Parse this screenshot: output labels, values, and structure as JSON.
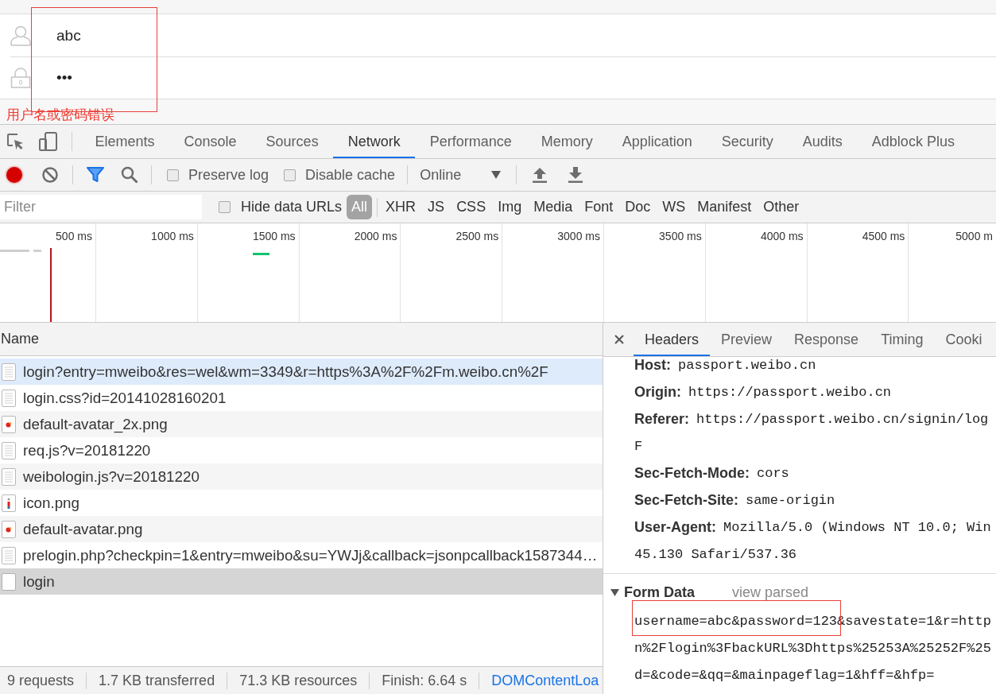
{
  "login_form": {
    "username": "abc",
    "password": "•••",
    "error": "用户名或密码错误"
  },
  "devtools": {
    "tabs": [
      {
        "label": "Elements",
        "selected": false
      },
      {
        "label": "Console",
        "selected": false
      },
      {
        "label": "Sources",
        "selected": false
      },
      {
        "label": "Network",
        "selected": true
      },
      {
        "label": "Performance",
        "selected": false
      },
      {
        "label": "Memory",
        "selected": false
      },
      {
        "label": "Application",
        "selected": false
      },
      {
        "label": "Security",
        "selected": false
      },
      {
        "label": "Audits",
        "selected": false
      },
      {
        "label": "Adblock Plus",
        "selected": false
      }
    ],
    "toolbar": {
      "recording": true,
      "filter_active": true,
      "options": [
        {
          "label": "Preserve log",
          "checked": false
        },
        {
          "label": "Disable cache",
          "checked": false
        }
      ],
      "throttling": "Online"
    },
    "filter_bar": {
      "placeholder": "Filter",
      "hide_data_urls": {
        "label": "Hide data URLs",
        "checked": false
      },
      "types": [
        {
          "label": "All",
          "selected": true
        },
        {
          "label": "XHR",
          "selected": false
        },
        {
          "label": "JS",
          "selected": false
        },
        {
          "label": "CSS",
          "selected": false
        },
        {
          "label": "Img",
          "selected": false
        },
        {
          "label": "Media",
          "selected": false
        },
        {
          "label": "Font",
          "selected": false
        },
        {
          "label": "Doc",
          "selected": false
        },
        {
          "label": "WS",
          "selected": false
        },
        {
          "label": "Manifest",
          "selected": false
        },
        {
          "label": "Other",
          "selected": false
        }
      ]
    },
    "timeline": {
      "ticks": [
        "500 ms",
        "1000 ms",
        "1500 ms",
        "2000 ms",
        "2500 ms",
        "3000 ms",
        "3500 ms",
        "4000 ms",
        "4500 ms",
        "5000 m"
      ]
    },
    "requests": {
      "column": "Name",
      "rows": [
        {
          "name": "login?entry=mweibo&res=wel&wm=3349&r=https%3A%2F%2Fm.weibo.cn%2F",
          "kind": "document",
          "selected": false,
          "highlighted": true
        },
        {
          "name": "login.css?id=20141028160201",
          "kind": "document",
          "selected": false,
          "highlighted": false
        },
        {
          "name": "default-avatar_2x.png",
          "kind": "image",
          "selected": false,
          "highlighted": false
        },
        {
          "name": "req.js?v=20181220",
          "kind": "document",
          "selected": false,
          "highlighted": false
        },
        {
          "name": "weibologin.js?v=20181220",
          "kind": "document",
          "selected": false,
          "highlighted": false
        },
        {
          "name": "icon.png",
          "kind": "image-tall",
          "selected": false,
          "highlighted": false
        },
        {
          "name": "default-avatar.png",
          "kind": "image",
          "selected": false,
          "highlighted": false
        },
        {
          "name": "prelogin.php?checkpin=1&entry=mweibo&su=YWJj&callback=jsonpcallback1587344…",
          "kind": "document",
          "selected": false,
          "highlighted": false
        },
        {
          "name": "login",
          "kind": "blank",
          "selected": true,
          "highlighted": false
        }
      ]
    },
    "status_bar": [
      {
        "text": "9 requests",
        "kind": "stat"
      },
      {
        "text": "1.7 KB transferred",
        "kind": "stat"
      },
      {
        "text": "71.3 KB resources",
        "kind": "stat"
      },
      {
        "text": "Finish: 6.64 s",
        "kind": "stat"
      },
      {
        "text": "DOMContentLoa",
        "kind": "event"
      }
    ],
    "details": {
      "tabs": [
        {
          "label": "Headers",
          "selected": true
        },
        {
          "label": "Preview",
          "selected": false
        },
        {
          "label": "Response",
          "selected": false
        },
        {
          "label": "Timing",
          "selected": false
        },
        {
          "label": "Cooki",
          "selected": false
        }
      ],
      "headers": [
        {
          "name": "Host:",
          "value": "passport.weibo.cn"
        },
        {
          "name": "Origin:",
          "value": "https://passport.weibo.cn"
        },
        {
          "name": "Referer:",
          "value": "https://passport.weibo.cn/signin/log"
        },
        {
          "value": "F"
        },
        {
          "name": "Sec-Fetch-Mode:",
          "value": "cors"
        },
        {
          "name": "Sec-Fetch-Site:",
          "value": "same-origin"
        },
        {
          "name": "User-Agent:",
          "value": "Mozilla/5.0 (Windows NT 10.0; Win"
        },
        {
          "value": "45.130 Safari/537.36"
        }
      ],
      "form_data": {
        "title": "Form Data",
        "expanded": true,
        "toggle": "view parsed",
        "lines": [
          "username=abc&password=123&savestate=1&r=http",
          "n%2Flogin%3FbackURL%3Dhttps%25253A%25252F%25",
          "d=&code=&qq=&mainpageflag=1&hff=&hfp="
        ]
      }
    }
  }
}
